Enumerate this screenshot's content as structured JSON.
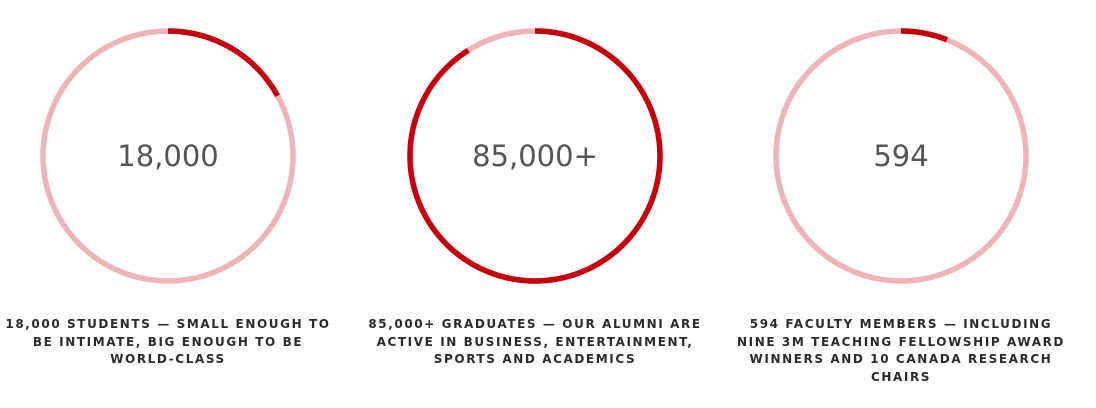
{
  "colors": {
    "track": "#eeb4b7",
    "progress": "#c8000b",
    "number": "#555555",
    "caption": "#2b2b2b"
  },
  "stats": [
    {
      "number": "18,000",
      "progress_fraction": 0.17,
      "caption_lines": [
        "18,000 STUDENTS — SMALL ENOUGH TO",
        "BE INTIMATE, BIG ENOUGH TO BE",
        "WORLD-CLASS"
      ]
    },
    {
      "number": "85,000+",
      "progress_fraction": 0.91,
      "caption_lines": [
        "85,000+ GRADUATES — OUR ALUMNI ARE",
        "ACTIVE IN BUSINESS, ENTERTAINMENT,",
        "SPORTS AND ACADEMICS"
      ]
    },
    {
      "number": "594",
      "progress_fraction": 0.06,
      "caption_lines": [
        "594 FACULTY MEMBERS — INCLUDING",
        "NINE 3M TEACHING FELLOWSHIP AWARD",
        "WINNERS AND 10 CANADA RESEARCH",
        "CHAIRS"
      ]
    }
  ]
}
